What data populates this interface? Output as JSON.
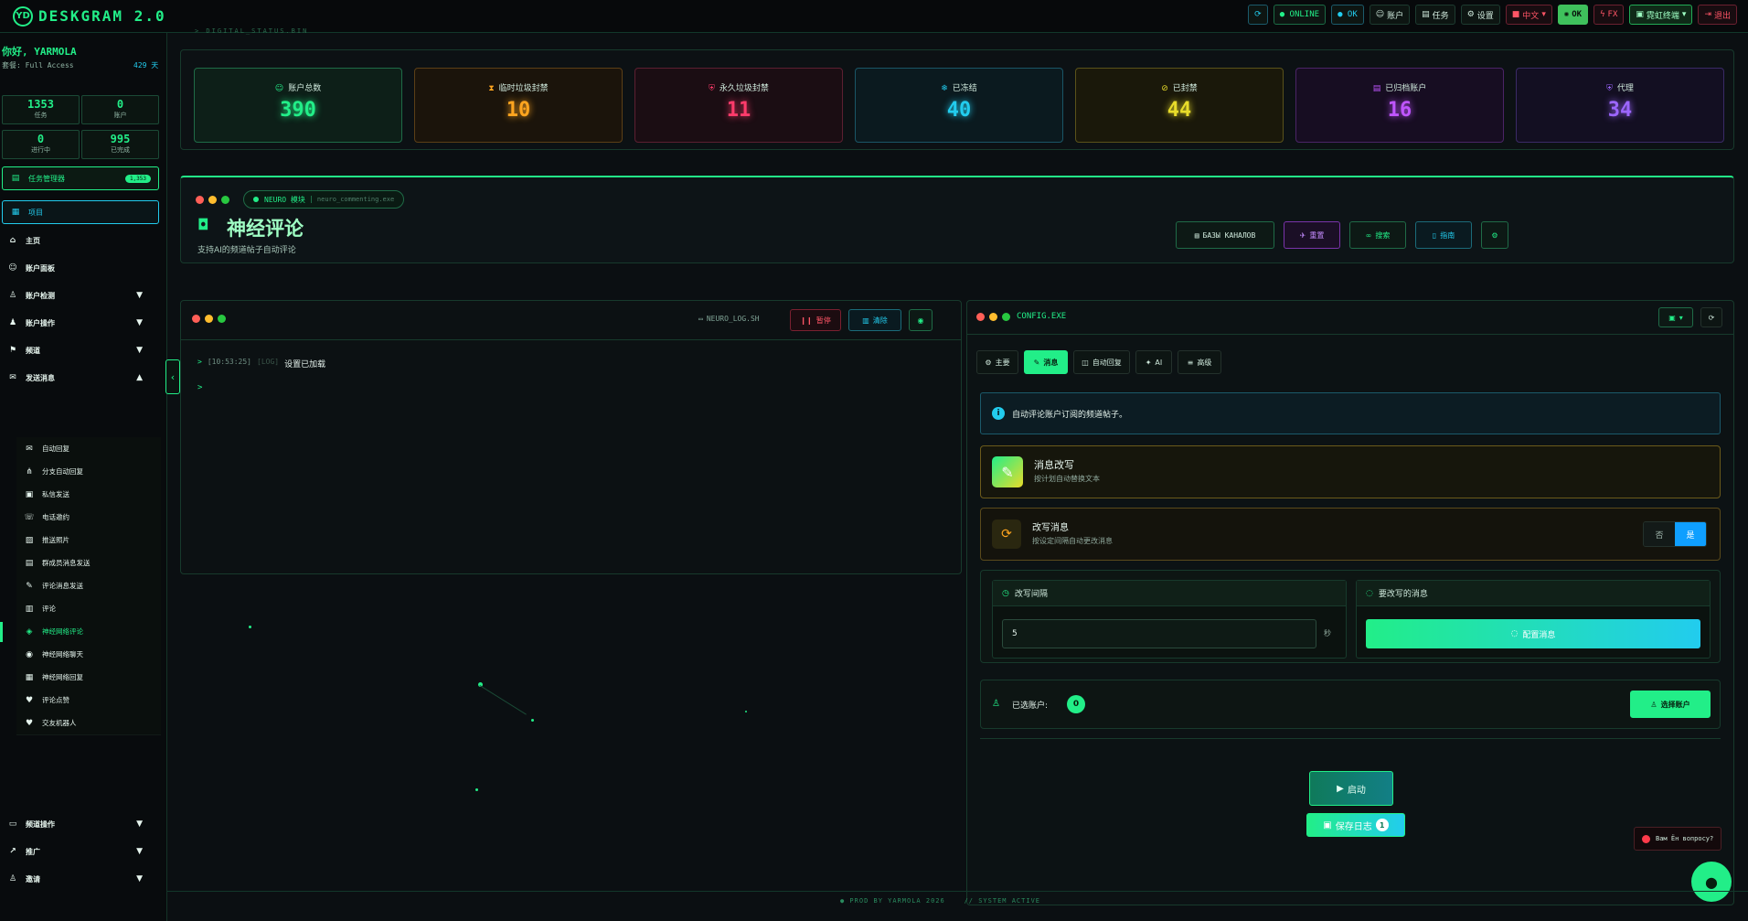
{
  "brand": {
    "mark": "YD",
    "name": "DESKGRAM 2.0"
  },
  "topbar": {
    "refresh": "⟳",
    "online": "● ONLINE",
    "ok": "● OK",
    "accounts": "账户",
    "tasks": "任务",
    "settings": "设置",
    "lang": "中文",
    "lang_flag": "■",
    "status_ok": "OK",
    "fx": "FX",
    "theme": "霓虹终端",
    "logout": "退出"
  },
  "sidebar": {
    "greeting": "你好, YARMOLA",
    "role": "套餐: Full Access",
    "days": "429 天",
    "stats": [
      {
        "value": "1353",
        "label": "任务"
      },
      {
        "value": "0",
        "label": "账户"
      },
      {
        "value": "0",
        "label": "进行中"
      },
      {
        "value": "995",
        "label": "已完成"
      }
    ],
    "task_manager": "任务管理器",
    "task_badge": "1,353",
    "queue": "项目",
    "nav": [
      {
        "label": "主页",
        "icon": "home-icon",
        "glyph": "⌂",
        "caret": ""
      },
      {
        "label": "账户面板",
        "icon": "users-icon",
        "glyph": "☺",
        "caret": ""
      },
      {
        "label": "账户检测",
        "icon": "user-check-icon",
        "glyph": "♙",
        "caret": "▼"
      },
      {
        "label": "账户操作",
        "icon": "user-cog-icon",
        "glyph": "♟",
        "caret": "▼"
      },
      {
        "label": "频道",
        "icon": "flag-icon",
        "glyph": "⚑",
        "caret": "▼"
      },
      {
        "label": "发送消息",
        "icon": "chat-icon",
        "glyph": "✉",
        "caret": "▲"
      }
    ],
    "sub": [
      {
        "label": "自动回复",
        "icon": "mail-icon",
        "glyph": "✉"
      },
      {
        "label": "分支自动回复",
        "icon": "tree-icon",
        "glyph": "⋔"
      },
      {
        "label": "私信发送",
        "icon": "inbox-icon",
        "glyph": "▣"
      },
      {
        "label": "电话邀约",
        "icon": "phone-icon",
        "glyph": "☏"
      },
      {
        "label": "推送照片",
        "icon": "image-icon",
        "glyph": "▨"
      },
      {
        "label": "群成员消息发送",
        "icon": "group-mail-icon",
        "glyph": "▤"
      },
      {
        "label": "评论消息发送",
        "icon": "comment-icon",
        "glyph": "✎"
      },
      {
        "label": "评论",
        "icon": "note-icon",
        "glyph": "▥"
      },
      {
        "label": "神经网络评论",
        "icon": "neuro-comment-icon",
        "glyph": "◈"
      },
      {
        "label": "神经网络聊天",
        "icon": "neuro-chat-icon",
        "glyph": "◉"
      },
      {
        "label": "神经网络回复",
        "icon": "neuro-reply-icon",
        "glyph": "▦"
      },
      {
        "label": "评论点赞",
        "icon": "heart-icon",
        "glyph": "♥"
      },
      {
        "label": "交友机器人",
        "icon": "heart-bot-icon",
        "glyph": "♥"
      }
    ],
    "nav2": [
      {
        "label": "频道操作",
        "icon": "briefcase-icon",
        "glyph": "▭",
        "caret": "▼"
      },
      {
        "label": "推广",
        "icon": "chart-icon",
        "glyph": "↗",
        "caret": "▼"
      },
      {
        "label": "邀请",
        "icon": "invite-icon",
        "glyph": "♙",
        "caret": "▼"
      }
    ]
  },
  "stats": [
    {
      "label": "账户总数",
      "value": "390",
      "icon": "users-icon",
      "glyph": "☺",
      "color": "#22ee88",
      "bg": "#0d1f18",
      "border": "#1f6b47"
    },
    {
      "label": "临时垃圾封禁",
      "value": "10",
      "icon": "hourglass-icon",
      "glyph": "⧗",
      "color": "#ffa51f",
      "bg": "#1b140b",
      "border": "#5c3f16"
    },
    {
      "label": "永久垃圾封禁",
      "value": "11",
      "icon": "shield-alert-icon",
      "glyph": "⛨",
      "color": "#ff3b6b",
      "bg": "#1b0d13",
      "border": "#5c1f31"
    },
    {
      "label": "已冻结",
      "value": "40",
      "icon": "snowflake-icon",
      "glyph": "❄",
      "color": "#22ccee",
      "bg": "#0b1a1f",
      "border": "#1a5566"
    },
    {
      "label": "已封禁",
      "value": "44",
      "icon": "ban-icon",
      "glyph": "⊘",
      "color": "#e8dc2a",
      "bg": "#1a180a",
      "border": "#5a521a"
    },
    {
      "label": "已归档账户",
      "value": "16",
      "icon": "archive-icon",
      "glyph": "▤",
      "color": "#bf55ff",
      "bg": "#170d22",
      "border": "#4a2466"
    },
    {
      "label": "代理",
      "value": "34",
      "icon": "shield-icon",
      "glyph": "⛨",
      "color": "#9c66ff",
      "bg": "#130f22",
      "border": "#3a2a66"
    }
  ],
  "stats_caption": "> DIGITAL_STATUS.BIN",
  "header": {
    "module_tag": "NEURO 模块",
    "module_file": "neuro_commenting.exe",
    "title": "神经评论",
    "subtitle": "支持AI的频道帖子自动评论",
    "btn_bases": "БАЗЫ КАНАЛОВ",
    "btn_reset": "重置",
    "btn_search": "搜索",
    "btn_guide": "指南"
  },
  "log": {
    "file": "NEURO_LOG.SH",
    "pause": "暂停",
    "clear": "清除",
    "entry_time": "[10:53:25]",
    "entry_tag": "[LOG]",
    "entry_text": "设置已加载",
    "prompt": ">"
  },
  "config": {
    "file": "CONFIG.EXE",
    "tabs": [
      {
        "label": "主要",
        "icon": "gear-icon",
        "glyph": "⚙"
      },
      {
        "label": "消息",
        "icon": "edit-icon",
        "glyph": "✎"
      },
      {
        "label": "自动回复",
        "icon": "robot-icon",
        "glyph": "◫"
      },
      {
        "label": "AI",
        "icon": "spark-icon",
        "glyph": "✦"
      },
      {
        "label": "高级",
        "icon": "sliders-icon",
        "glyph": "≡"
      }
    ],
    "info": "自动评论账户订阅的频道帖子。",
    "rewrite_title": "消息改写",
    "rewrite_desc": "按计划自动替换文本",
    "change_title": "改写消息",
    "change_desc": "按设定间隔自动更改消息",
    "toggle_no": "否",
    "toggle_yes": "是",
    "interval_label": "改写间隔",
    "interval_value": "5",
    "interval_unit": "秒",
    "messages_label": "要改写的消息",
    "messages_btn": "配置消息",
    "selected_label": "已选账户:",
    "selected_count": "0",
    "select_btn": "选择账户",
    "start": "启动",
    "save_log": "保存日志",
    "save_count": "1"
  },
  "widget": {
    "question": "Вам Ён вопросу?"
  },
  "footer": "● PROD BY YARMOLA 2026    // SYSTEM ACTIVE"
}
